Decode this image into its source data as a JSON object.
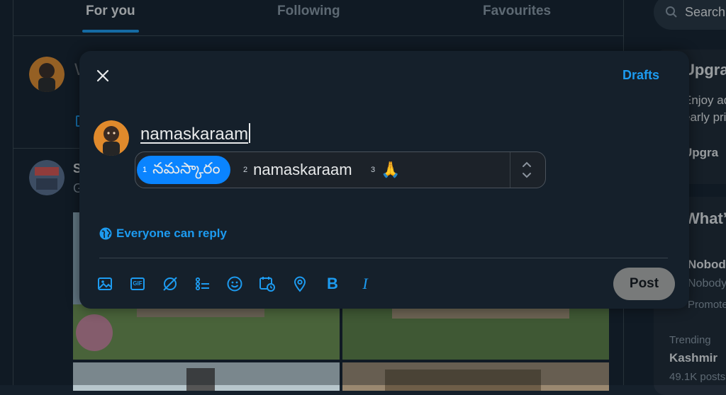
{
  "tabs": [
    {
      "label": "For you"
    },
    {
      "label": "Following"
    },
    {
      "label": "Favourites"
    }
  ],
  "search": {
    "placeholder": "Search"
  },
  "sidebar": {
    "premium_title": "Upgrade",
    "premium_line1": "Enjoy ade",
    "premium_line2": "early pric",
    "premium_button": "Upgra",
    "whats_title": "What’s",
    "item1_title": "Nobody",
    "item1_sub": "Nobody S",
    "item1_meta": "Promoted",
    "trend_label": "Trending",
    "trend_title": "Kashmir",
    "trend_count": "49.1K posts"
  },
  "background": {
    "compose_placeholder": "W",
    "tweet_author_initial": "S",
    "tweet_text_initial": "G"
  },
  "composer": {
    "drafts_label": "Drafts",
    "text": "namaskaraam",
    "candidates": [
      {
        "num": "1",
        "text": "నమస్కారం"
      },
      {
        "num": "2",
        "text": "namaskaraam"
      },
      {
        "num": "3",
        "text": "🙏"
      }
    ],
    "reply_setting": "Everyone can reply",
    "toolbar": {
      "media": "image-icon",
      "gif": "GIF",
      "grok": "grok-icon",
      "poll": "poll-icon",
      "emoji": "emoji-icon",
      "schedule": "schedule-icon",
      "location": "location-icon",
      "bold": "B",
      "italic": "I"
    },
    "post_label": "Post"
  },
  "colors": {
    "background": "#15202b",
    "accent": "#1d9bf0",
    "ime_highlight": "#0a84ff",
    "post_button": "#787a7a"
  }
}
